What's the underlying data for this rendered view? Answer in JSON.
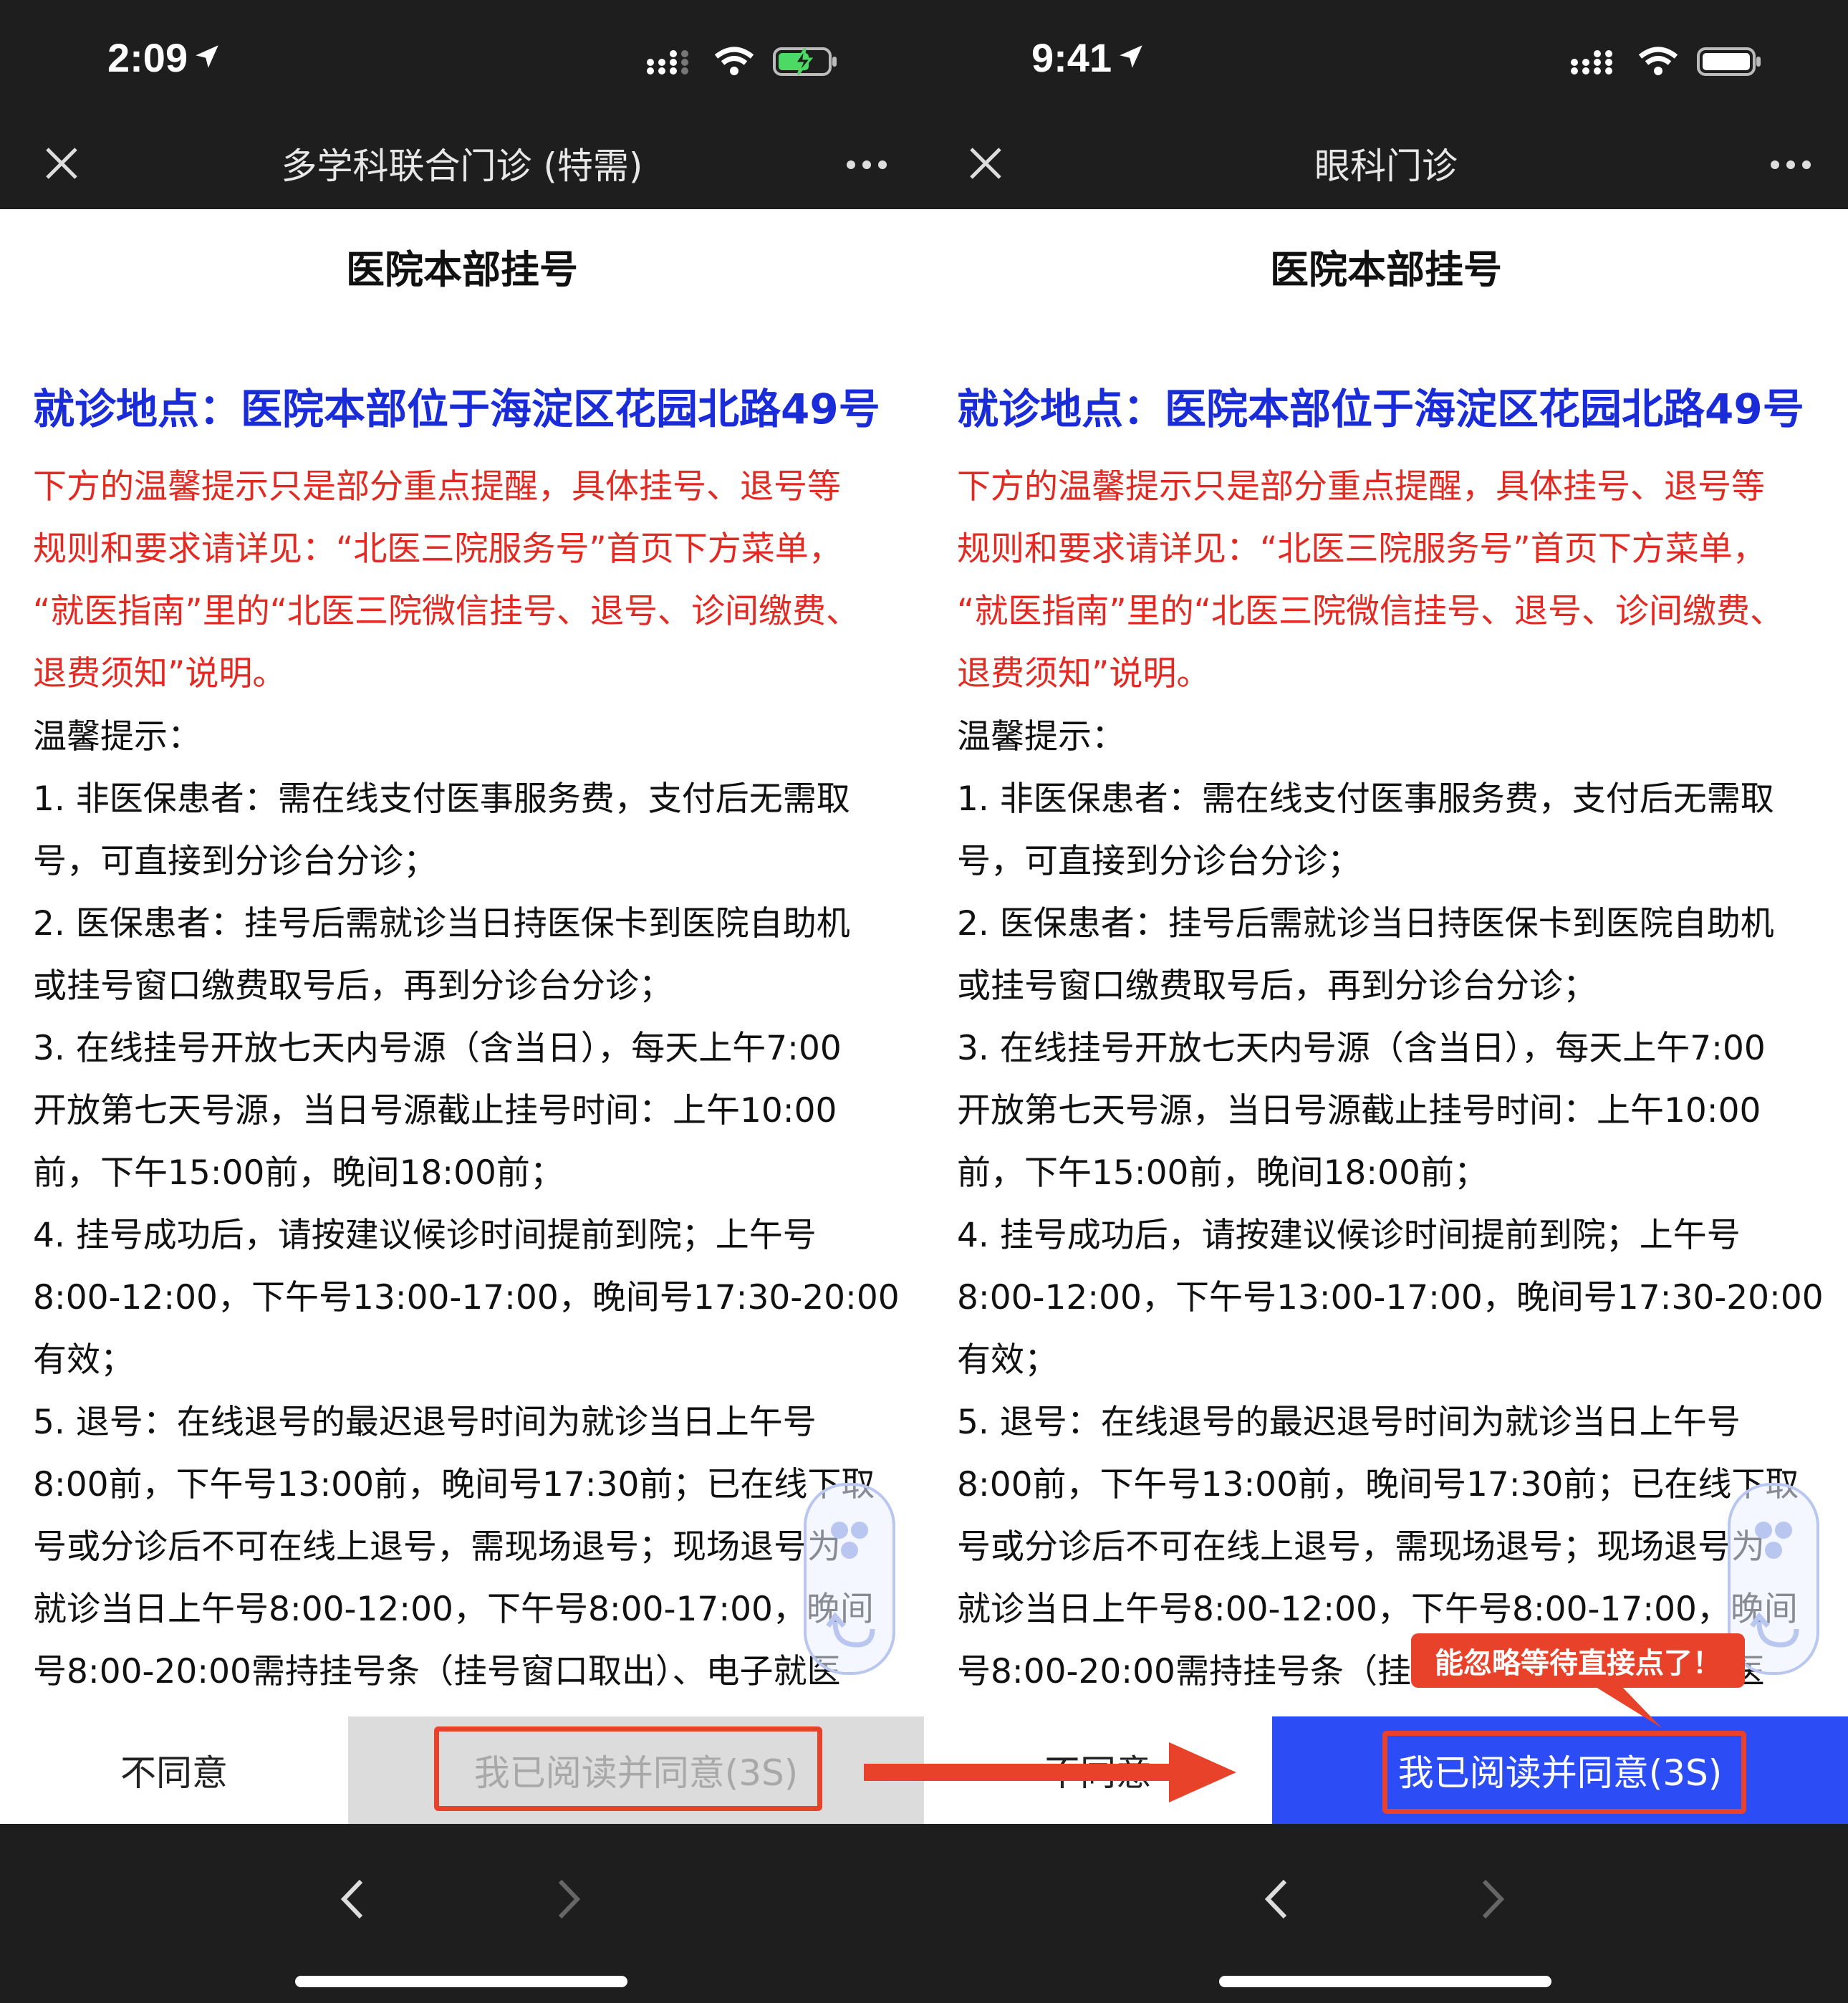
{
  "left": {
    "status_time": "2:09",
    "nav_title": "多学科联合门诊 (特需)",
    "heading": "医院本部挂号",
    "location": "就诊地点：医院本部位于海淀区花园北路49号",
    "notice_lines": [
      "下方的温馨提示只是部分重点提醒，具体挂号、退号等",
      "规则和要求请详见：“北医三院服务号”首页下方菜单，",
      "“就医指南”里的“北医三院微信挂号、退号、诊间缴费、",
      "退费须知”说明。"
    ],
    "tips_lines": [
      "温馨提示：",
      "1. 非医保患者：需在线支付医事服务费，支付后无需取",
      "号，可直接到分诊台分诊；",
      "2. 医保患者：挂号后需就诊当日持医保卡到医院自助机",
      "或挂号窗口缴费取号后，再到分诊台分诊；",
      "3. 在线挂号开放七天内号源（含当日），每天上午7:00",
      "开放第七天号源，当日号源截止挂号时间：上午10:00",
      "前，下午15:00前，晚间18:00前；",
      "4. 挂号成功后，请按建议候诊时间提前到院；上午号",
      "8:00-12:00，下午号13:00-17:00，晚间号17:30-20:00",
      "有效；",
      "5. 退号：在线退号的最迟退号时间为就诊当日上午号",
      "8:00前，下午号13:00前，晚间号17:30前；已在线下取",
      "号或分诊后不可在线上退号，需现场退号；现场退号为",
      "就诊当日上午号8:00-12:00，下午号8:00-17:00，晚间",
      "号8:00-20:00需持挂号条（挂号窗口取出）、电子就医"
    ],
    "disagree_label": "不同意",
    "agree_label": "我已阅读并同意(3S)"
  },
  "right": {
    "status_time": "9:41",
    "nav_title": "眼科门诊",
    "heading": "医院本部挂号",
    "location": "就诊地点：医院本部位于海淀区花园北路49号",
    "notice_lines": [
      "下方的温馨提示只是部分重点提醒，具体挂号、退号等",
      "规则和要求请详见：“北医三院服务号”首页下方菜单，",
      "“就医指南”里的“北医三院微信挂号、退号、诊间缴费、",
      "退费须知”说明。"
    ],
    "tips_lines": [
      "温馨提示：",
      "1. 非医保患者：需在线支付医事服务费，支付后无需取",
      "号，可直接到分诊台分诊；",
      "2. 医保患者：挂号后需就诊当日持医保卡到医院自助机",
      "或挂号窗口缴费取号后，再到分诊台分诊；",
      "3. 在线挂号开放七天内号源（含当日），每天上午7:00",
      "开放第七天号源，当日号源截止挂号时间：上午10:00",
      "前，下午15:00前，晚间18:00前；",
      "4. 挂号成功后，请按建议候诊时间提前到院；上午号",
      "8:00-12:00，下午号13:00-17:00，晚间号17:30-20:00",
      "有效；",
      "5. 退号：在线退号的最迟退号时间为就诊当日上午号",
      "8:00前，下午号13:00前，晚间号17:30前；已在线下取",
      "号或分诊后不可在线上退号，需现场退号；现场退号为",
      "就诊当日上午号8:00-12:00，下午号8:00-17:00，晚间",
      "号8:00-20:00需持挂号条（挂号窗口取出）、电子就医"
    ],
    "disagree_label": "不同意",
    "agree_label": "我已阅读并同意(3S)"
  },
  "annotation": {
    "callout_text": "能忽略等待直接点了！",
    "color": "#e8422a"
  },
  "colors": {
    "location_blue": "#1a2bd8",
    "notice_red": "#e22a23",
    "agree_enabled": "#2c4df5",
    "agree_disabled": "#dcdcdc",
    "battery_charging": "#4cd964"
  },
  "icons": [
    "location-arrow-icon",
    "signal-icon",
    "wifi-icon",
    "battery-icon",
    "close-icon",
    "more-icon",
    "back-icon",
    "forward-icon"
  ]
}
